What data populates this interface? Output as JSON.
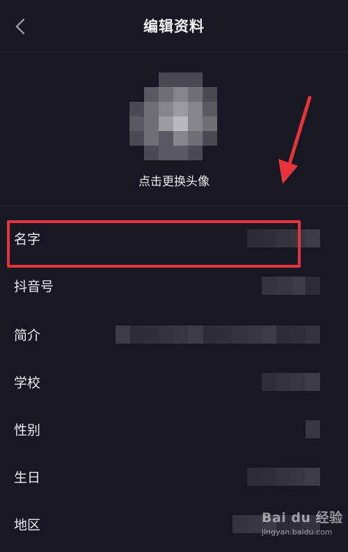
{
  "header": {
    "title": "编辑资料",
    "back_icon": "chevron-left-icon"
  },
  "avatar": {
    "change_label": "点击更换头像"
  },
  "fields": [
    {
      "label": "名字"
    },
    {
      "label": "抖音号"
    },
    {
      "label": "简介"
    },
    {
      "label": "学校"
    },
    {
      "label": "性别"
    },
    {
      "label": "生日"
    },
    {
      "label": "地区"
    }
  ],
  "annotation": {
    "box_color": "#e8333a",
    "arrow_color": "#e8333a"
  },
  "watermark": {
    "logo_text": "Bai du 经验",
    "url": "jingyan.baidu.com"
  },
  "colors": {
    "background": "#161823",
    "text": "#ececee",
    "divider": "#25262f"
  }
}
